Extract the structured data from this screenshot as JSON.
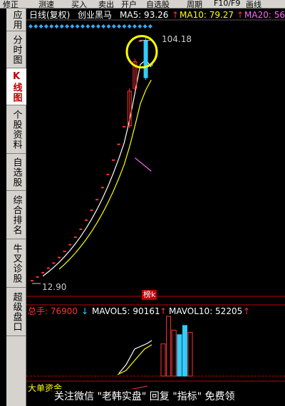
{
  "toolbar": {
    "items": [
      "修正",
      "测速",
      "买入",
      "卖出",
      "开户",
      "自选股",
      "周期",
      "F10/F9",
      "画线"
    ]
  },
  "sidebar": {
    "tabs": [
      {
        "label": "应用",
        "active": false
      },
      {
        "label": "分时图",
        "active": false
      },
      {
        "label": "K线图",
        "active": true
      },
      {
        "label": "个股资料",
        "active": false
      },
      {
        "label": "自选股",
        "active": false
      },
      {
        "label": "综合排名",
        "active": false
      },
      {
        "label": "牛叉诊股",
        "active": false
      },
      {
        "label": "超级盘口",
        "active": false
      }
    ]
  },
  "kline_header": {
    "period": "日线(复权)",
    "name": "创业黑马",
    "ma5_label": "MA5: 93.26",
    "ma10_label": "MA10: 79.27",
    "ma20_label": "MA20: 56"
  },
  "price_annotations": {
    "high_label": "104.18",
    "low_label": "12.90",
    "badge": "榜k"
  },
  "volume_header": {
    "total_label": "总手: 76900",
    "mavol5_label": "MAVOL5: 90161",
    "mavol10_label": "MAVOL10: 52205"
  },
  "indicator_label": "大单资金",
  "watermark": "关注微信 \"老韩实盘\" 回复 \"指标\" 免费领",
  "colors": {
    "up": "#ff3333",
    "down": "#33ccff",
    "ma5": "#ffffff",
    "ma10": "#ffff00",
    "ma20": "#ff66ff",
    "diamond": "#33aaff",
    "circle": "#ffff00"
  },
  "chart_data": {
    "type": "candlestick",
    "price_candles": [
      {
        "open": 12.9,
        "close": 14.2
      },
      {
        "open": 14.2,
        "close": 15.6
      },
      {
        "open": 15.6,
        "close": 17.2
      },
      {
        "open": 17.2,
        "close": 18.9
      },
      {
        "open": 18.9,
        "close": 20.8
      },
      {
        "open": 20.8,
        "close": 22.9
      },
      {
        "open": 22.9,
        "close": 25.2
      },
      {
        "open": 25.2,
        "close": 27.7
      },
      {
        "open": 27.7,
        "close": 30.5
      },
      {
        "open": 30.5,
        "close": 33.5
      },
      {
        "open": 33.5,
        "close": 36.9
      },
      {
        "open": 36.9,
        "close": 40.6
      },
      {
        "open": 40.6,
        "close": 44.6
      },
      {
        "open": 44.6,
        "close": 49.1
      },
      {
        "open": 49.1,
        "close": 54.0
      },
      {
        "open": 54.0,
        "close": 59.4
      },
      {
        "open": 59.4,
        "close": 65.3
      },
      {
        "open": 65.3,
        "close": 71.9
      },
      {
        "open": 72.0,
        "close": 85.0
      },
      {
        "open": 86.0,
        "close": 96.0
      },
      {
        "open": 97.0,
        "close": 104.0
      },
      {
        "open": 104.0,
        "close": 90.0
      },
      {
        "open": 95.0,
        "close": 88.0
      }
    ],
    "volume_bars": [
      {
        "value": 0.2,
        "up": true
      },
      {
        "value": 0.2,
        "up": true
      },
      {
        "value": 0.2,
        "up": true
      },
      {
        "value": 0.2,
        "up": true
      },
      {
        "value": 0.2,
        "up": true
      },
      {
        "value": 0.2,
        "up": true
      },
      {
        "value": 0.2,
        "up": true
      },
      {
        "value": 0.2,
        "up": true
      },
      {
        "value": 0.2,
        "up": true
      },
      {
        "value": 0.2,
        "up": true
      },
      {
        "value": 0.2,
        "up": true
      },
      {
        "value": 0.2,
        "up": true
      },
      {
        "value": 0.2,
        "up": true
      },
      {
        "value": 0.2,
        "up": true
      },
      {
        "value": 0.2,
        "up": true
      },
      {
        "value": 0.3,
        "up": true
      },
      {
        "value": 0.3,
        "up": true
      },
      {
        "value": 7.0,
        "up": true
      },
      {
        "value": 13.0,
        "up": true
      },
      {
        "value": 10.0,
        "up": true
      },
      {
        "value": 9.0,
        "up": false
      },
      {
        "value": 11.0,
        "up": false
      },
      {
        "value": 9.5,
        "up": true
      }
    ],
    "y_range": [
      12.9,
      104.18
    ]
  }
}
